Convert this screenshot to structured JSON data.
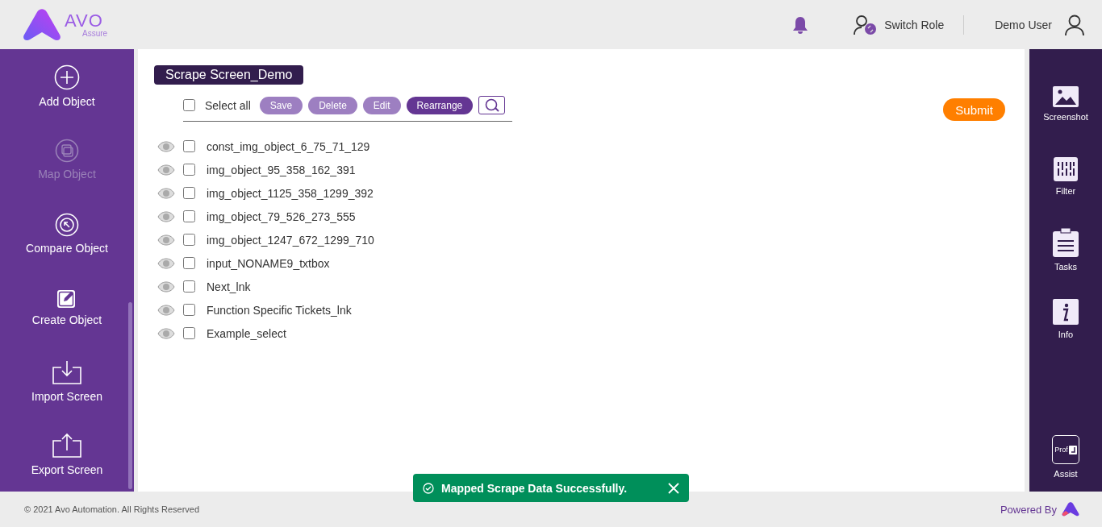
{
  "header": {
    "logo_text": "AVO",
    "logo_subtext": "Assure",
    "switch_role": "Switch Role",
    "user_name": "Demo User"
  },
  "left_sidebar": [
    {
      "kind": "add",
      "label": "Add Object",
      "disabled": false
    },
    {
      "kind": "map",
      "label": "Map Object",
      "disabled": true
    },
    {
      "kind": "compare",
      "label": "Compare Object",
      "disabled": false
    },
    {
      "kind": "create",
      "label": "Create Object",
      "disabled": false
    },
    {
      "kind": "import",
      "label": "Import Screen",
      "disabled": false
    },
    {
      "kind": "export",
      "label": "Export Screen",
      "disabled": false
    }
  ],
  "screen_title": "Scrape Screen_Demo",
  "toolbar": {
    "select_all": {
      "label": "Select all",
      "checked": false
    },
    "buttons": [
      {
        "label": "Save",
        "disabled": true
      },
      {
        "label": "Delete",
        "disabled": true
      },
      {
        "label": "Edit",
        "disabled": true
      },
      {
        "label": "Rearrange",
        "disabled": false
      }
    ]
  },
  "submit": "Submit",
  "objects": [
    {
      "name": "const_img_object_6_75_71_129",
      "checked": false
    },
    {
      "name": "img_object_95_358_162_391",
      "checked": false
    },
    {
      "name": "img_object_1125_358_1299_392",
      "checked": false
    },
    {
      "name": "img_object_79_526_273_555",
      "checked": false
    },
    {
      "name": "img_object_1247_672_1299_710",
      "checked": false
    },
    {
      "name": "input_NONAME9_txtbox",
      "checked": false
    },
    {
      "name": "Next_lnk",
      "checked": false
    },
    {
      "name": "Function Specific Tickets_lnk",
      "checked": false
    },
    {
      "name": "Example_select",
      "checked": false
    }
  ],
  "right_sidebar": [
    {
      "kind": "screenshot",
      "label": "Screenshot"
    },
    {
      "kind": "filter",
      "label": "Filter"
    },
    {
      "kind": "tasks",
      "label": "Tasks"
    },
    {
      "kind": "info",
      "label": "Info"
    },
    {
      "kind": "assist",
      "label": "Assist",
      "icon_text": "Prof"
    }
  ],
  "toast": {
    "message": "Mapped Scrape Data Successfully."
  },
  "footer": {
    "copyright": "© 2021 Avo Automation. All Rights Reserved",
    "powered_by": "Powered By"
  }
}
